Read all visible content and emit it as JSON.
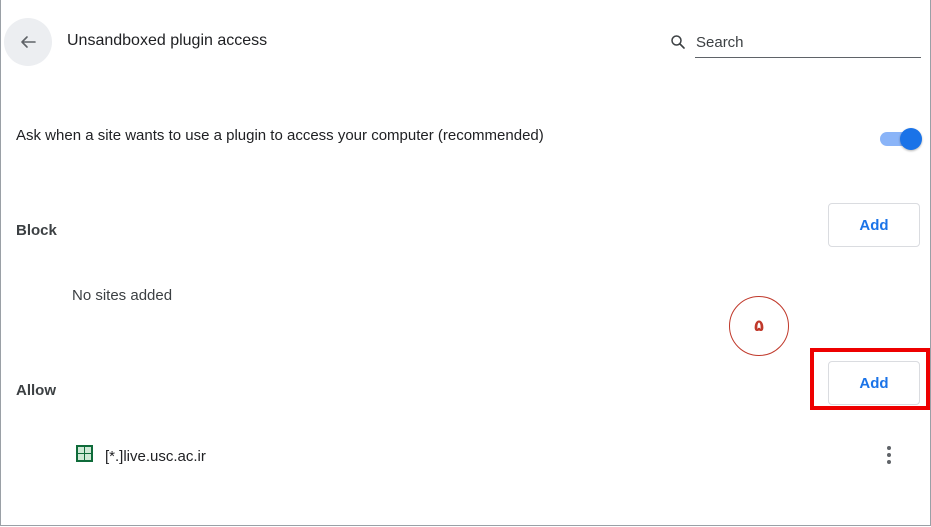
{
  "header": {
    "back_icon": "arrow-back-icon",
    "title": "Unsandboxed plugin access",
    "search": {
      "placeholder": "Search",
      "value": "",
      "icon": "search-icon"
    }
  },
  "setting": {
    "label": "Ask when a site wants to use a plugin to access your computer (recommended)",
    "toggle_on": true
  },
  "block": {
    "label": "Block",
    "add_label": "Add",
    "empty_text": "No sites added"
  },
  "annotation": {
    "step_label": "۵"
  },
  "allow": {
    "label": "Allow",
    "add_label": "Add",
    "sites": [
      {
        "pattern": "[*.]live.usc.ac.ir",
        "icon": "site-favicon-icon",
        "menu_icon": "more-vert-icon"
      }
    ]
  },
  "colors": {
    "accent": "#1a73e8",
    "toggle_track": "#8ab4f8",
    "highlight": "#ee0000",
    "favicon": "#0f6b3a"
  }
}
